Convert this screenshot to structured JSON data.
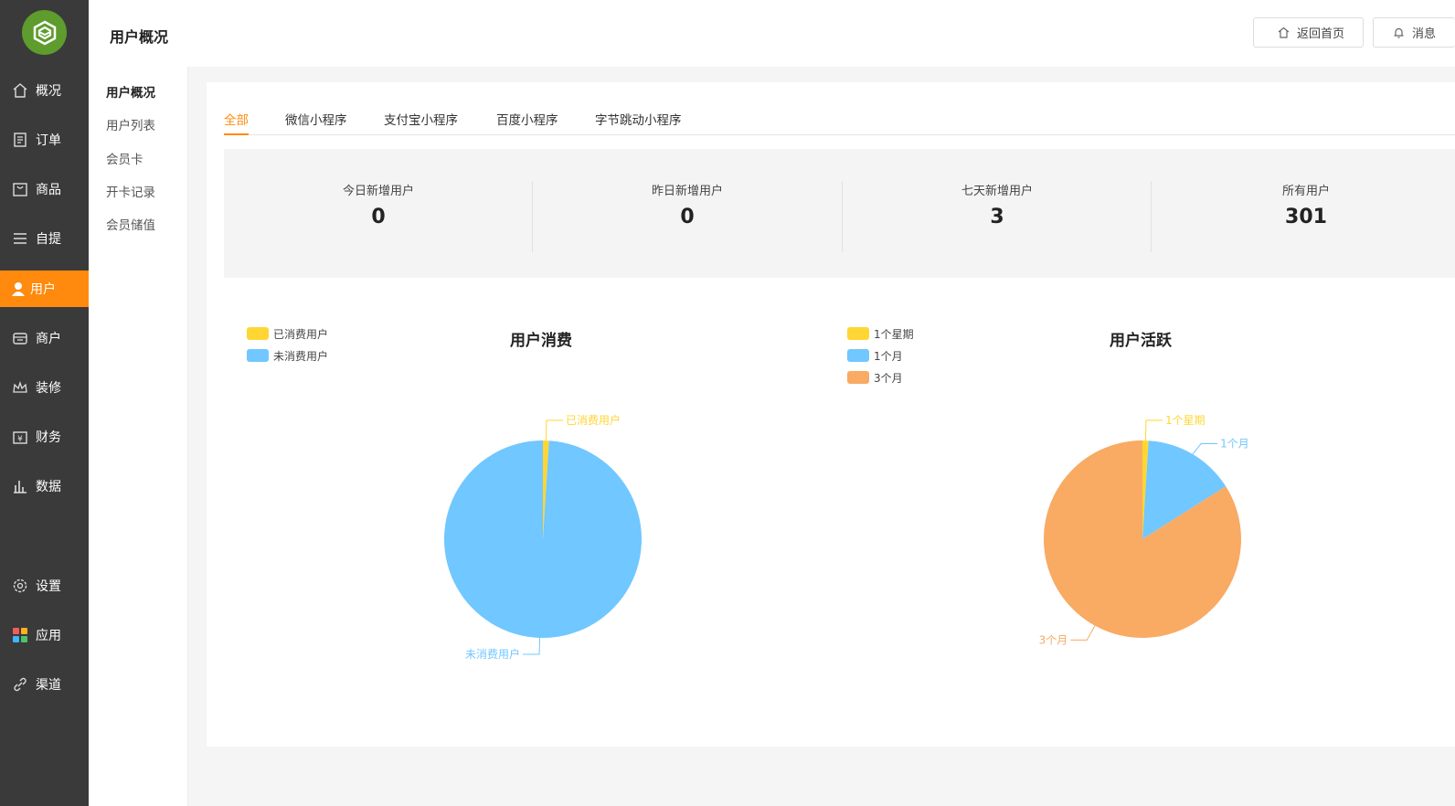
{
  "nav": {
    "items": [
      {
        "label": "概况",
        "icon": "home-icon"
      },
      {
        "label": "订单",
        "icon": "order-icon"
      },
      {
        "label": "商品",
        "icon": "bag-icon"
      },
      {
        "label": "自提",
        "icon": "menu-icon"
      },
      {
        "label": "用户",
        "icon": "user-icon"
      },
      {
        "label": "商户",
        "icon": "store-icon"
      },
      {
        "label": "装修",
        "icon": "crown-icon"
      },
      {
        "label": "财务",
        "icon": "finance-icon"
      },
      {
        "label": "数据",
        "icon": "bar-chart-icon"
      },
      {
        "label": "设置",
        "icon": "gear-icon"
      },
      {
        "label": "应用",
        "icon": "apps-icon"
      },
      {
        "label": "渠道",
        "icon": "link-icon"
      }
    ]
  },
  "subnav": {
    "items": [
      "用户概况",
      "用户列表",
      "会员卡",
      "开卡记录",
      "会员储值"
    ]
  },
  "header": {
    "title": "用户概况",
    "home_button": "返回首页",
    "message_button": "消息"
  },
  "tabs": [
    "全部",
    "微信小程序",
    "支付宝小程序",
    "百度小程序",
    "字节跳动小程序"
  ],
  "stats": [
    {
      "label": "今日新增用户",
      "value": "0"
    },
    {
      "label": "昨日新增用户",
      "value": "0"
    },
    {
      "label": "七天新增用户",
      "value": "3"
    },
    {
      "label": "所有用户",
      "value": "301"
    }
  ],
  "chart_data": [
    {
      "type": "pie",
      "title": "用户消费",
      "legend_position": "top-left",
      "slices": [
        {
          "name": "已消费用户",
          "value": 1,
          "color": "#ffd633"
        },
        {
          "name": "未消费用户",
          "value": 99,
          "color": "#71c7ff"
        }
      ]
    },
    {
      "type": "pie",
      "title": "用户活跃",
      "legend_position": "top-left",
      "slices": [
        {
          "name": "1个星期",
          "value": 1,
          "color": "#ffd633"
        },
        {
          "name": "1个月",
          "value": 15,
          "color": "#71c7ff"
        },
        {
          "name": "3个月",
          "value": 84,
          "color": "#f9aa63"
        }
      ]
    }
  ]
}
